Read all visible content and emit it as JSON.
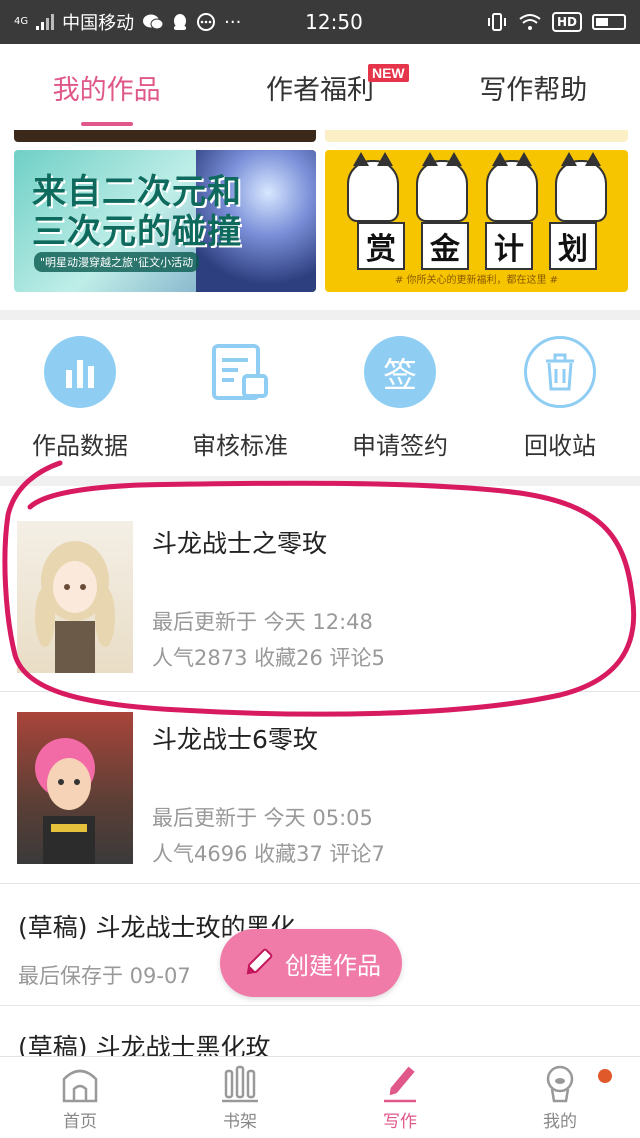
{
  "status_bar": {
    "network": "4G",
    "carrier": "中国移动",
    "extra": "···",
    "time": "12:50",
    "hd": "HD"
  },
  "tabs": [
    {
      "label": "我的作品",
      "active": true
    },
    {
      "label": "作者福利",
      "badge": "NEW"
    },
    {
      "label": "写作帮助"
    }
  ],
  "banners": {
    "left": {
      "title_line1": "来自二次元和",
      "title_line2": "三次元的碰撞",
      "subtitle": "\"明星动漫穿越之旅\"征文小活动"
    },
    "right": {
      "chars": [
        "赏",
        "金",
        "计",
        "划"
      ],
      "subtitle": "# 你所关心的更新福利，都在这里 #"
    }
  },
  "actions": [
    {
      "label": "作品数据",
      "icon": "bar-chart-icon"
    },
    {
      "label": "审核标准",
      "icon": "review-standard-icon"
    },
    {
      "label": "申请签约",
      "icon": "sign-contract-icon",
      "icon_char": "签"
    },
    {
      "label": "回收站",
      "icon": "trash-icon"
    }
  ],
  "works": [
    {
      "title": "斗龙战士之零玫",
      "updated": "最后更新于 今天 12:48",
      "stats": "人气2873 收藏26 评论5"
    },
    {
      "title": "斗龙战士6零玫",
      "updated": "最后更新于 今天 05:05",
      "stats": "人气4696 收藏37 评论7"
    }
  ],
  "drafts": [
    {
      "title": "(草稿) 斗龙战士玫的黑化",
      "saved": "最后保存于 09-07"
    },
    {
      "title": "(草稿) 斗龙战士黑化玫"
    }
  ],
  "fab": {
    "label": "创建作品"
  },
  "bottom_nav": [
    {
      "label": "首页",
      "icon": "home-icon"
    },
    {
      "label": "书架",
      "icon": "bookshelf-icon"
    },
    {
      "label": "写作",
      "icon": "pen-icon",
      "active": true
    },
    {
      "label": "我的",
      "icon": "profile-icon",
      "has_dot": true
    }
  ],
  "colors": {
    "accent": "#e0588a",
    "fab": "#f07aa8",
    "action_icon": "#8fcdf3",
    "badge": "#e6344a"
  }
}
